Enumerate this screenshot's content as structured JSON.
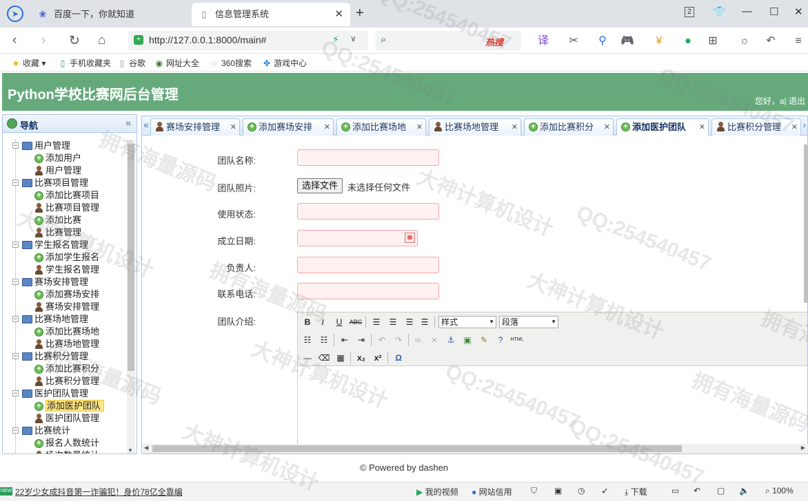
{
  "browser": {
    "tabs": [
      {
        "title": "百度一下，你就知道",
        "icon": "paw-icon"
      },
      {
        "title": "信息管理系统",
        "icon": "page-icon"
      }
    ],
    "tab_count": "2",
    "url": "http://127.0.0.1:8000/main#",
    "search_hot": "热搜",
    "bookmarks": [
      "收藏",
      "手机收藏夹",
      "谷歌",
      "网址大全",
      "360搜索",
      "游戏中心"
    ],
    "zoom": "100%"
  },
  "app": {
    "title": "Python学校比赛网后台管理",
    "user_greeting": "您好，a| 退出",
    "accent_color": "#66aa7c"
  },
  "sidebar": {
    "title": "导航",
    "tree": [
      {
        "label": "用户管理",
        "children": [
          {
            "label": "添加用户",
            "icon": "add"
          },
          {
            "label": "用户管理",
            "icon": "user"
          }
        ]
      },
      {
        "label": "比赛项目管理",
        "children": [
          {
            "label": "添加比赛项目",
            "icon": "add"
          },
          {
            "label": "比赛项目管理",
            "icon": "user"
          },
          {
            "label": "添加比赛",
            "icon": "add"
          },
          {
            "label": "比赛管理",
            "icon": "user"
          }
        ]
      },
      {
        "label": "学生报名管理",
        "children": [
          {
            "label": "添加学生报名",
            "icon": "add"
          },
          {
            "label": "学生报名管理",
            "icon": "user"
          }
        ]
      },
      {
        "label": "赛场安排管理",
        "children": [
          {
            "label": "添加赛场安排",
            "icon": "add"
          },
          {
            "label": "赛场安排管理",
            "icon": "user"
          }
        ]
      },
      {
        "label": "比赛场地管理",
        "children": [
          {
            "label": "添加比赛场地",
            "icon": "add"
          },
          {
            "label": "比赛场地管理",
            "icon": "user"
          }
        ]
      },
      {
        "label": "比赛积分管理",
        "children": [
          {
            "label": "添加比赛积分",
            "icon": "add"
          },
          {
            "label": "比赛积分管理",
            "icon": "user"
          }
        ]
      },
      {
        "label": "医护团队管理",
        "children": [
          {
            "label": "添加医护团队",
            "icon": "add",
            "selected": true
          },
          {
            "label": "医护团队管理",
            "icon": "user"
          }
        ]
      },
      {
        "label": "比赛统计",
        "children": [
          {
            "label": "报名人数统计",
            "icon": "add"
          },
          {
            "label": "场次数量统计",
            "icon": "user"
          }
        ]
      }
    ]
  },
  "tabs": [
    {
      "label": "赛场安排管理",
      "icon": "user"
    },
    {
      "label": "添加赛场安排",
      "icon": "add"
    },
    {
      "label": "添加比赛场地",
      "icon": "add"
    },
    {
      "label": "比赛场地管理",
      "icon": "user"
    },
    {
      "label": "添加比赛积分",
      "icon": "add"
    },
    {
      "label": "添加医护团队",
      "icon": "add",
      "active": true
    },
    {
      "label": "比赛积分管理",
      "icon": "user"
    }
  ],
  "form": {
    "team_name_label": "团队名称:",
    "team_photo_label": "团队照片:",
    "file_button": "选择文件",
    "file_status": "未选择任何文件",
    "status_label": "使用状态:",
    "date_label": "成立日期:",
    "leader_label": "负责人:",
    "phone_label": "联系电话:",
    "intro_label": "团队介绍:",
    "editor_style_select": "样式",
    "editor_para_select": "段落"
  },
  "footer": "© Powered by dashen",
  "statusbar": {
    "news": "22岁少女成抖音第一诈骗犯！身价78亿全靠编",
    "video": "我的视频",
    "netuse": "网站信用",
    "download": "下载",
    "zoom": "100%"
  },
  "watermarks": [
    "QQ:254540457",
    "拥有海量源码",
    "大神计算机设计"
  ]
}
